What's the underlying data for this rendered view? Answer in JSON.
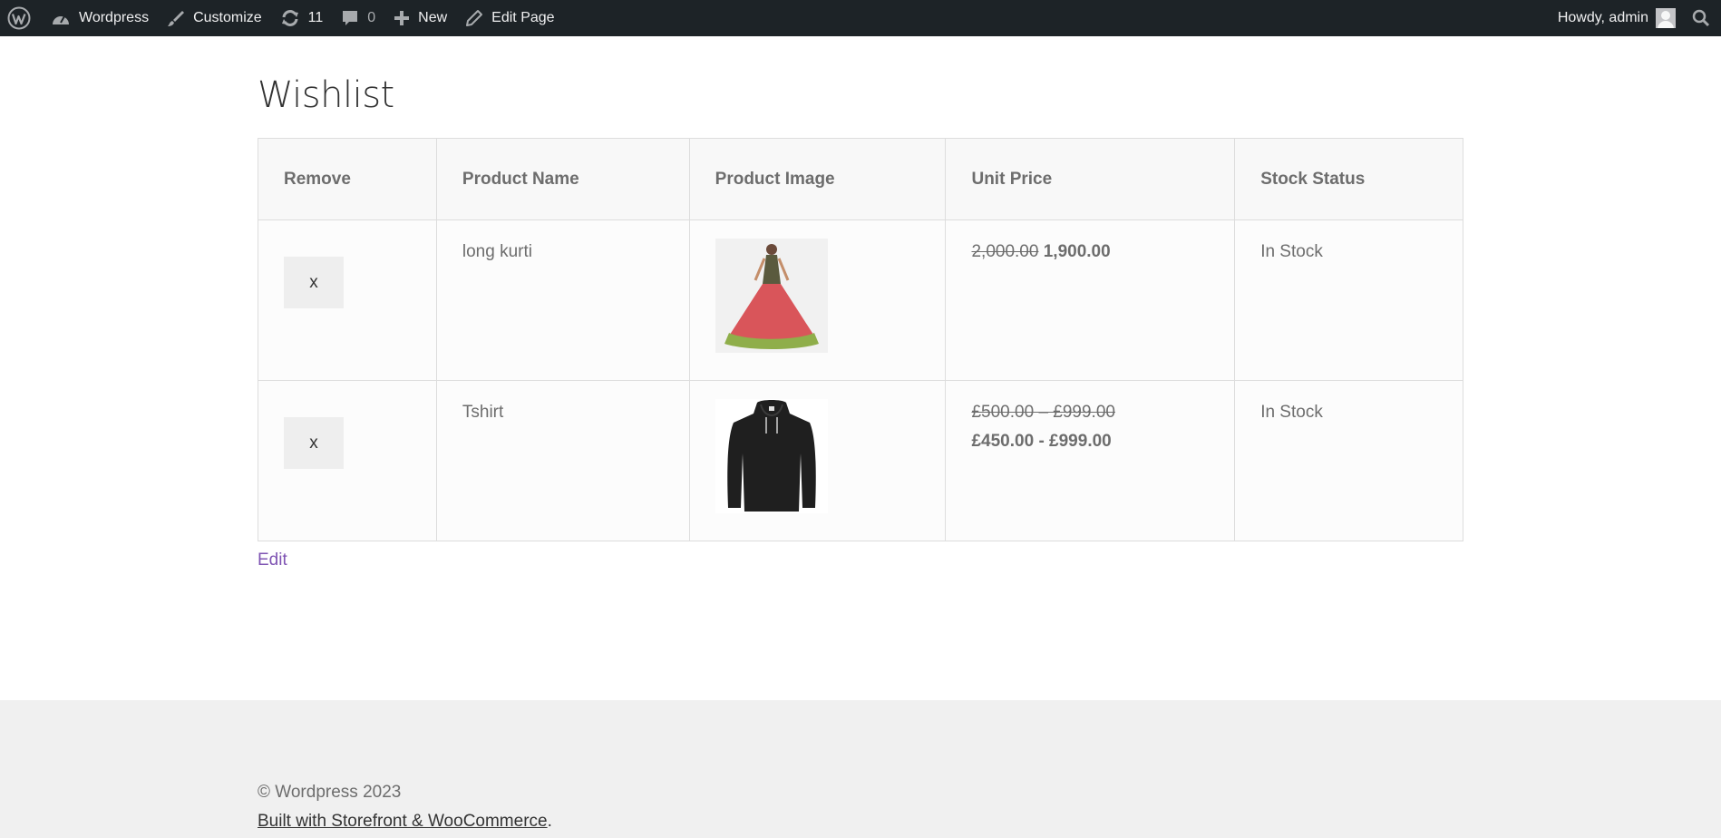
{
  "admin_bar": {
    "site_name": "Wordpress",
    "customize": "Customize",
    "updates_count": "11",
    "comments_count": "0",
    "new": "New",
    "edit_page": "Edit Page",
    "howdy": "Howdy, admin"
  },
  "page": {
    "title": "Wishlist",
    "edit_link": "Edit"
  },
  "table": {
    "headers": [
      "Remove",
      "Product Name",
      "Product Image",
      "Unit Price",
      "Stock Status"
    ],
    "rows": [
      {
        "remove": "x",
        "name": "long kurti",
        "image": "kurti-dress-image",
        "price_old": "2,000.00",
        "price_new": "1,900.00",
        "stock": "In Stock"
      },
      {
        "remove": "x",
        "name": "Tshirt",
        "image": "black-hoodie-image",
        "price_old": "£500.00 – £999.00",
        "price_new": "£450.00 - £999.00",
        "stock": "In Stock"
      }
    ]
  },
  "footer": {
    "copyright": "© Wordpress 2023",
    "built_with": "Built with Storefront & WooCommerce",
    "period": "."
  },
  "colors": {
    "admin_bar_bg": "#1d2327",
    "link_purple": "#7f54b3",
    "footer_bg": "#f0f0f0"
  }
}
